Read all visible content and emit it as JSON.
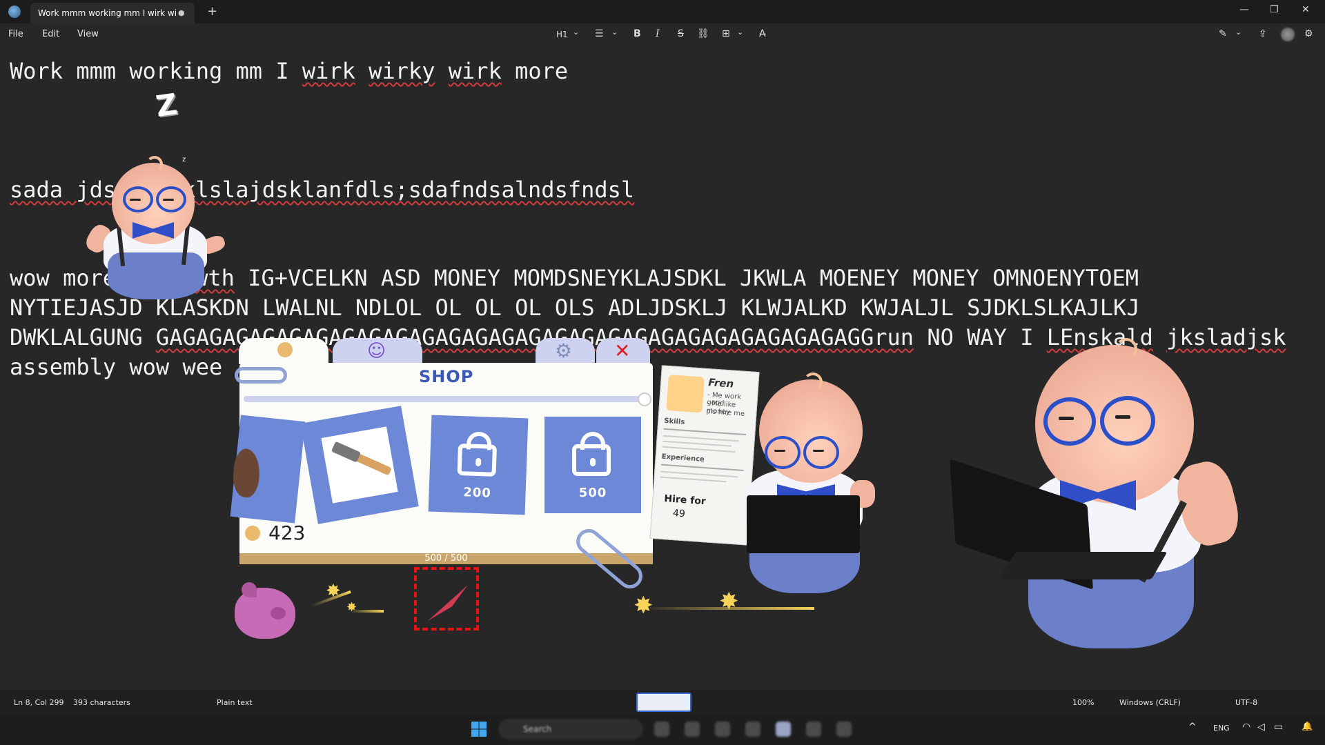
{
  "window": {
    "tab_title": "Work mmm working  mm I wirk wi",
    "tab_modified": "●",
    "new_tab": "+",
    "minimize": "—",
    "maximize": "❐",
    "close": "✕"
  },
  "menu": {
    "file": "File",
    "edit": "Edit",
    "view": "View"
  },
  "toolbar": {
    "heading": "H1",
    "heading_chevron": "⌄",
    "list": "☰",
    "list_chevron": "⌄",
    "bold": "B",
    "italic": "I",
    "strike": "S",
    "link": "⛓",
    "table": "⊞",
    "table_chevron": "⌄",
    "clear_format": "A̶",
    "pen": "✎",
    "pen_chevron": "⌄",
    "share": "⇪",
    "settings": "⚙"
  },
  "document": {
    "line1": [
      "Work mmm working  mm I ",
      "wirk",
      " ",
      "wirky",
      " ",
      "wirk",
      " more"
    ],
    "line2": [
      "sada jds",
      "klslajdsklanfdls;sdafndsalndsfndsl"
    ],
    "line3a": "wow more",
    "line3b": "wth",
    "line3c": " IG+VCELKN ASD MONEY MOMDSNEYKLAJSDKL JKWLA MOENEY MONEY OMNOENYTOEM",
    "line4": "NYTIEJASJD KLASKDN LWALNL NDLOL OL OL OL OLS ADLJDSKLJ KLWJALKD KWJALJL SJDKLSLKAJLKJ",
    "line5a": "DWKLALGUNG ",
    "line5b": "GAGAGAGAGAGAGAGAGAGAGAGAGAGAGAGAGAGAGAGAGAGAGAGAGAGAGGrun",
    "line5c": " NO WAY I ",
    "line5d": "LEnskald",
    "line5e": " ",
    "line5f": "jksladjsk",
    "line6": "assembly wow wee"
  },
  "sleep": {
    "z_big": "Z",
    "z_small": "z"
  },
  "shop": {
    "title": "SHOP",
    "tab_smile": "☺",
    "tab_gear": "⚙",
    "tab_close": "✕",
    "items": [
      {
        "name": "hand",
        "locked": false
      },
      {
        "name": "hammer",
        "locked": false
      },
      {
        "name": "locked-item",
        "locked": true,
        "price": "200"
      },
      {
        "name": "locked-item",
        "locked": true,
        "price": "500"
      }
    ],
    "coins": "423",
    "capacity": "500 / 500",
    "colors": {
      "accent": "#3b57b8",
      "card": "#6d88d6",
      "coin": "#e9b96e"
    }
  },
  "resume": {
    "name": "Fren",
    "bullets": [
      "- Me work good",
      "- Me like money",
      "  pls hire me"
    ],
    "skills": "Skills",
    "experience": "Experience",
    "hire_label": "Hire for",
    "hire_value": "49"
  },
  "status": {
    "position": "Ln 8, Col 299",
    "chars": "393 characters",
    "format": "Plain text",
    "zoom": "100%",
    "line_ending": "Windows (CRLF)",
    "encoding": "UTF-8"
  },
  "taskbar": {
    "search": "Search",
    "lang": "ENG",
    "chevron": "^",
    "wifi": "◠",
    "volume": "◁",
    "battery": "▭",
    "bell": "🔔"
  }
}
